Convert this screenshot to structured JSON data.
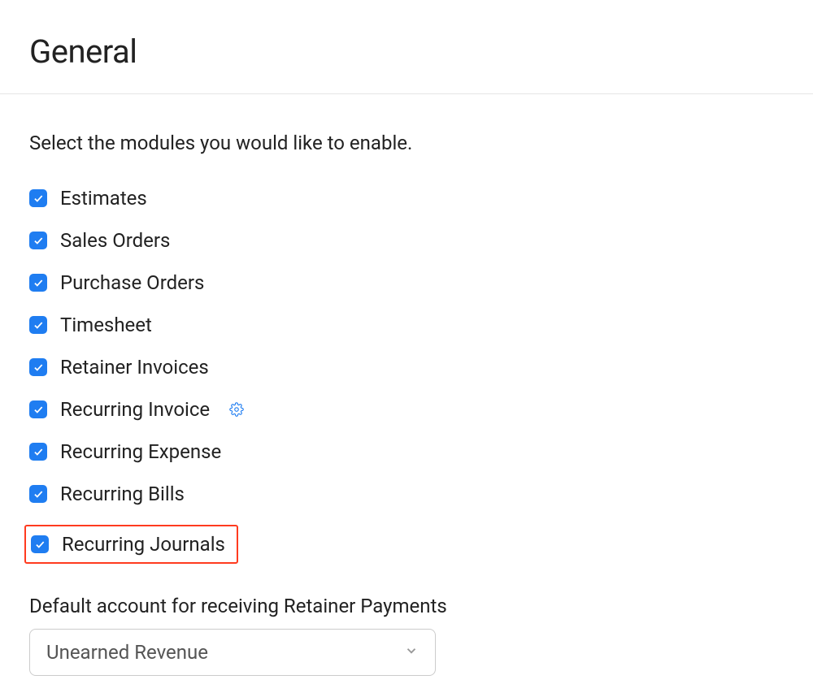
{
  "header": {
    "title": "General"
  },
  "instruction": "Select the modules you would like to enable.",
  "modules": [
    {
      "label": "Estimates",
      "checked": true,
      "hasSettings": false,
      "highlighted": false
    },
    {
      "label": "Sales Orders",
      "checked": true,
      "hasSettings": false,
      "highlighted": false
    },
    {
      "label": "Purchase Orders",
      "checked": true,
      "hasSettings": false,
      "highlighted": false
    },
    {
      "label": "Timesheet",
      "checked": true,
      "hasSettings": false,
      "highlighted": false
    },
    {
      "label": "Retainer Invoices",
      "checked": true,
      "hasSettings": false,
      "highlighted": false
    },
    {
      "label": "Recurring Invoice",
      "checked": true,
      "hasSettings": true,
      "highlighted": false
    },
    {
      "label": "Recurring Expense",
      "checked": true,
      "hasSettings": false,
      "highlighted": false
    },
    {
      "label": "Recurring Bills",
      "checked": true,
      "hasSettings": false,
      "highlighted": false
    },
    {
      "label": "Recurring Journals",
      "checked": true,
      "hasSettings": false,
      "highlighted": true
    }
  ],
  "defaultAccount": {
    "label": "Default account for receiving Retainer Payments",
    "selected": "Unearned Revenue"
  }
}
